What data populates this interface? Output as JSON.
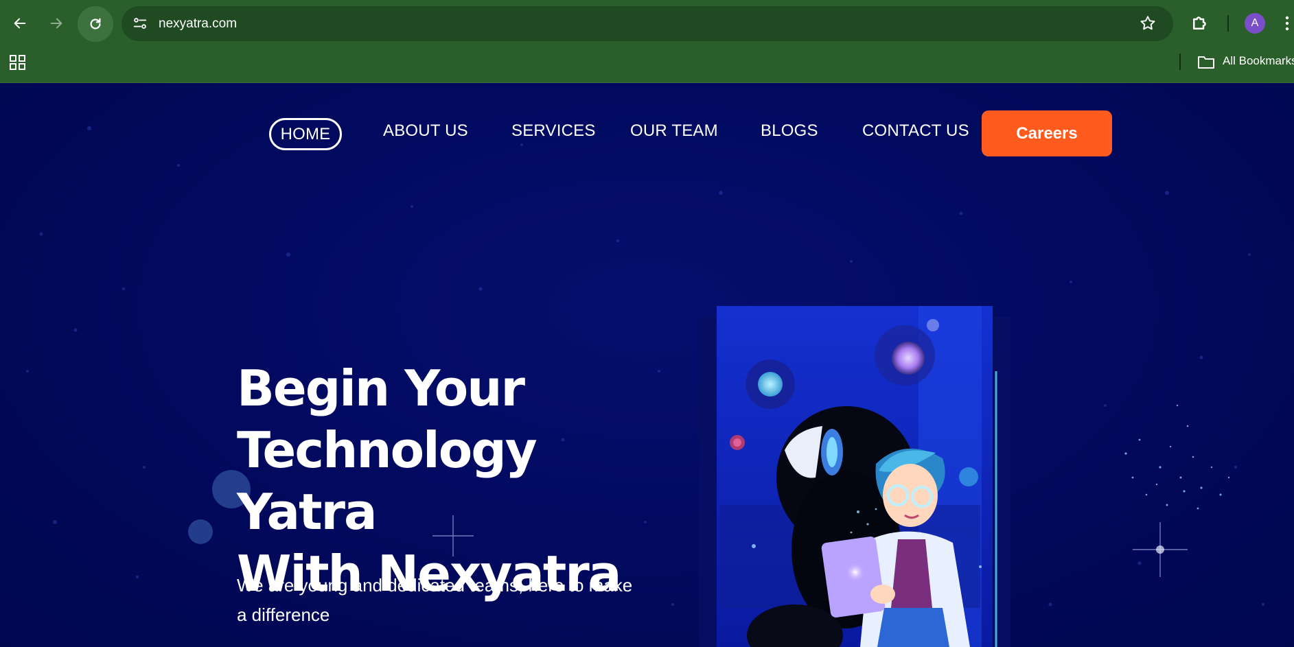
{
  "browser": {
    "url": "nexyatra.com",
    "profile_initial": "A",
    "bookmarks_label": "All Bookmarks"
  },
  "nav": {
    "home": "HOME",
    "about": "ABOUT US",
    "services": "SERVICES",
    "team": "OUR TEAM",
    "blogs": "BLOGS",
    "contact": "CONTACT US",
    "careers": "Careers"
  },
  "hero": {
    "title_lines": [
      "Begin Your",
      "Technology Yatra",
      "With Nexyatra"
    ],
    "subtitle": "We are young and dedicated teams, here to make a difference"
  },
  "colors": {
    "chrome_bg": "#2a5e2a",
    "site_bg": "#010a5e",
    "accent": "#ff5b1f",
    "text": "#ffffff"
  },
  "icons": {
    "back": "arrow-left-icon",
    "forward": "arrow-right-icon",
    "reload": "reload-icon",
    "site_info": "tune-icon",
    "bookmark": "star-icon",
    "extensions": "puzzle-icon",
    "menu": "kebab-menu-icon",
    "apps": "apps-grid-icon",
    "folder": "folder-icon"
  }
}
